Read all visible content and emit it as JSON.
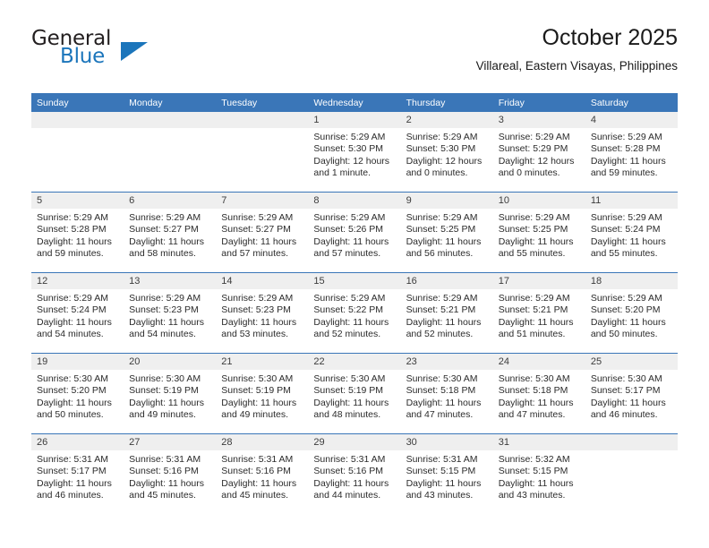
{
  "brand": {
    "name_primary": "General",
    "name_secondary": "Blue",
    "triangle_icon": "triangle-icon"
  },
  "header": {
    "title": "October 2025",
    "subtitle": "Villareal, Eastern Visayas, Philippines"
  },
  "calendar": {
    "weekday_headers": [
      "Sunday",
      "Monday",
      "Tuesday",
      "Wednesday",
      "Thursday",
      "Friday",
      "Saturday"
    ],
    "accent_color": "#3a76b8",
    "daynum_bg": "#efefef",
    "weeks": [
      [
        {
          "day": "",
          "empty": true
        },
        {
          "day": "",
          "empty": true
        },
        {
          "day": "",
          "empty": true
        },
        {
          "day": "1",
          "sunrise": "Sunrise: 5:29 AM",
          "sunset": "Sunset: 5:30 PM",
          "daylight1": "Daylight: 12 hours",
          "daylight2": "and 1 minute."
        },
        {
          "day": "2",
          "sunrise": "Sunrise: 5:29 AM",
          "sunset": "Sunset: 5:30 PM",
          "daylight1": "Daylight: 12 hours",
          "daylight2": "and 0 minutes."
        },
        {
          "day": "3",
          "sunrise": "Sunrise: 5:29 AM",
          "sunset": "Sunset: 5:29 PM",
          "daylight1": "Daylight: 12 hours",
          "daylight2": "and 0 minutes."
        },
        {
          "day": "4",
          "sunrise": "Sunrise: 5:29 AM",
          "sunset": "Sunset: 5:28 PM",
          "daylight1": "Daylight: 11 hours",
          "daylight2": "and 59 minutes."
        }
      ],
      [
        {
          "day": "5",
          "sunrise": "Sunrise: 5:29 AM",
          "sunset": "Sunset: 5:28 PM",
          "daylight1": "Daylight: 11 hours",
          "daylight2": "and 59 minutes."
        },
        {
          "day": "6",
          "sunrise": "Sunrise: 5:29 AM",
          "sunset": "Sunset: 5:27 PM",
          "daylight1": "Daylight: 11 hours",
          "daylight2": "and 58 minutes."
        },
        {
          "day": "7",
          "sunrise": "Sunrise: 5:29 AM",
          "sunset": "Sunset: 5:27 PM",
          "daylight1": "Daylight: 11 hours",
          "daylight2": "and 57 minutes."
        },
        {
          "day": "8",
          "sunrise": "Sunrise: 5:29 AM",
          "sunset": "Sunset: 5:26 PM",
          "daylight1": "Daylight: 11 hours",
          "daylight2": "and 57 minutes."
        },
        {
          "day": "9",
          "sunrise": "Sunrise: 5:29 AM",
          "sunset": "Sunset: 5:25 PM",
          "daylight1": "Daylight: 11 hours",
          "daylight2": "and 56 minutes."
        },
        {
          "day": "10",
          "sunrise": "Sunrise: 5:29 AM",
          "sunset": "Sunset: 5:25 PM",
          "daylight1": "Daylight: 11 hours",
          "daylight2": "and 55 minutes."
        },
        {
          "day": "11",
          "sunrise": "Sunrise: 5:29 AM",
          "sunset": "Sunset: 5:24 PM",
          "daylight1": "Daylight: 11 hours",
          "daylight2": "and 55 minutes."
        }
      ],
      [
        {
          "day": "12",
          "sunrise": "Sunrise: 5:29 AM",
          "sunset": "Sunset: 5:24 PM",
          "daylight1": "Daylight: 11 hours",
          "daylight2": "and 54 minutes."
        },
        {
          "day": "13",
          "sunrise": "Sunrise: 5:29 AM",
          "sunset": "Sunset: 5:23 PM",
          "daylight1": "Daylight: 11 hours",
          "daylight2": "and 54 minutes."
        },
        {
          "day": "14",
          "sunrise": "Sunrise: 5:29 AM",
          "sunset": "Sunset: 5:23 PM",
          "daylight1": "Daylight: 11 hours",
          "daylight2": "and 53 minutes."
        },
        {
          "day": "15",
          "sunrise": "Sunrise: 5:29 AM",
          "sunset": "Sunset: 5:22 PM",
          "daylight1": "Daylight: 11 hours",
          "daylight2": "and 52 minutes."
        },
        {
          "day": "16",
          "sunrise": "Sunrise: 5:29 AM",
          "sunset": "Sunset: 5:21 PM",
          "daylight1": "Daylight: 11 hours",
          "daylight2": "and 52 minutes."
        },
        {
          "day": "17",
          "sunrise": "Sunrise: 5:29 AM",
          "sunset": "Sunset: 5:21 PM",
          "daylight1": "Daylight: 11 hours",
          "daylight2": "and 51 minutes."
        },
        {
          "day": "18",
          "sunrise": "Sunrise: 5:29 AM",
          "sunset": "Sunset: 5:20 PM",
          "daylight1": "Daylight: 11 hours",
          "daylight2": "and 50 minutes."
        }
      ],
      [
        {
          "day": "19",
          "sunrise": "Sunrise: 5:30 AM",
          "sunset": "Sunset: 5:20 PM",
          "daylight1": "Daylight: 11 hours",
          "daylight2": "and 50 minutes."
        },
        {
          "day": "20",
          "sunrise": "Sunrise: 5:30 AM",
          "sunset": "Sunset: 5:19 PM",
          "daylight1": "Daylight: 11 hours",
          "daylight2": "and 49 minutes."
        },
        {
          "day": "21",
          "sunrise": "Sunrise: 5:30 AM",
          "sunset": "Sunset: 5:19 PM",
          "daylight1": "Daylight: 11 hours",
          "daylight2": "and 49 minutes."
        },
        {
          "day": "22",
          "sunrise": "Sunrise: 5:30 AM",
          "sunset": "Sunset: 5:19 PM",
          "daylight1": "Daylight: 11 hours",
          "daylight2": "and 48 minutes."
        },
        {
          "day": "23",
          "sunrise": "Sunrise: 5:30 AM",
          "sunset": "Sunset: 5:18 PM",
          "daylight1": "Daylight: 11 hours",
          "daylight2": "and 47 minutes."
        },
        {
          "day": "24",
          "sunrise": "Sunrise: 5:30 AM",
          "sunset": "Sunset: 5:18 PM",
          "daylight1": "Daylight: 11 hours",
          "daylight2": "and 47 minutes."
        },
        {
          "day": "25",
          "sunrise": "Sunrise: 5:30 AM",
          "sunset": "Sunset: 5:17 PM",
          "daylight1": "Daylight: 11 hours",
          "daylight2": "and 46 minutes."
        }
      ],
      [
        {
          "day": "26",
          "sunrise": "Sunrise: 5:31 AM",
          "sunset": "Sunset: 5:17 PM",
          "daylight1": "Daylight: 11 hours",
          "daylight2": "and 46 minutes."
        },
        {
          "day": "27",
          "sunrise": "Sunrise: 5:31 AM",
          "sunset": "Sunset: 5:16 PM",
          "daylight1": "Daylight: 11 hours",
          "daylight2": "and 45 minutes."
        },
        {
          "day": "28",
          "sunrise": "Sunrise: 5:31 AM",
          "sunset": "Sunset: 5:16 PM",
          "daylight1": "Daylight: 11 hours",
          "daylight2": "and 45 minutes."
        },
        {
          "day": "29",
          "sunrise": "Sunrise: 5:31 AM",
          "sunset": "Sunset: 5:16 PM",
          "daylight1": "Daylight: 11 hours",
          "daylight2": "and 44 minutes."
        },
        {
          "day": "30",
          "sunrise": "Sunrise: 5:31 AM",
          "sunset": "Sunset: 5:15 PM",
          "daylight1": "Daylight: 11 hours",
          "daylight2": "and 43 minutes."
        },
        {
          "day": "31",
          "sunrise": "Sunrise: 5:32 AM",
          "sunset": "Sunset: 5:15 PM",
          "daylight1": "Daylight: 11 hours",
          "daylight2": "and 43 minutes."
        },
        {
          "day": "",
          "empty": true
        }
      ]
    ]
  }
}
